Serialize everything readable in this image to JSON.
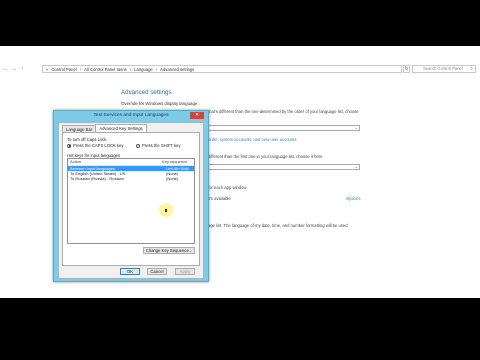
{
  "address_bar": {
    "back_icon": "back-arrow",
    "forward_icon": "forward-arrow",
    "up_icon": "up-arrow",
    "crumbs": [
      "«",
      "Control Panel",
      "›",
      "All Control Panel Items",
      "›",
      "Language",
      "›",
      "Advanced settings"
    ],
    "refresh_icon": "refresh-icon",
    "search_placeholder": "Search Control Panel"
  },
  "page": {
    "title": "Advanced settings",
    "subtitle": "Override for Windows display language",
    "text1": "that's different than the one determined by the order of your language list, choose",
    "link1": "order, system accounts, and new user accounts",
    "text2": "different than the first one in your language list, choose it here",
    "text3": "for each app window",
    "text4": "it's available",
    "link2": "Options",
    "text5": "age list. The language of my date, time, and number formatting will be used"
  },
  "dialog": {
    "title": "Text Services and Input Languages",
    "close_label": "✕",
    "tabs": [
      {
        "label": "Language Bar",
        "active": false
      },
      {
        "label": "Advanced Key Settings",
        "active": true
      }
    ],
    "caps_lock_label": "To turn off Caps Lock",
    "radio_capslock": "Press the CAPS LOCK key",
    "radio_shift": "Press the SHIFT key",
    "hotkeys_label": "Hot keys for input languages",
    "table_headers": [
      "Action",
      "Key sequence"
    ],
    "rows": [
      {
        "action": "Between input languages",
        "key": "Left Alt+Shift",
        "selected": true
      },
      {
        "action": "To English (United States) - US",
        "key": "(None)",
        "selected": false
      },
      {
        "action": "To Russian (Russia) - Russian",
        "key": "(None)",
        "selected": false
      }
    ],
    "change_button": "Change Key Sequence...",
    "ok": "OK",
    "cancel": "Cancel",
    "apply": "Apply"
  }
}
